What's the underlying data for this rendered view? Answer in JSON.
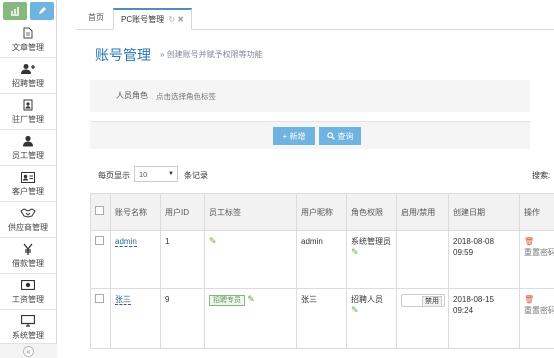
{
  "sidebar": {
    "items": [
      {
        "label": "文章管理",
        "icon": "document-icon"
      },
      {
        "label": "招聘管理",
        "icon": "user-add-icon"
      },
      {
        "label": "驻厂管理",
        "icon": "badge-icon"
      },
      {
        "label": "员工管理",
        "icon": "user-icon"
      },
      {
        "label": "客户管理",
        "icon": "id-card-icon"
      },
      {
        "label": "供应商管理",
        "icon": "handshake-icon"
      },
      {
        "label": "借款管理",
        "icon": "yen-icon"
      },
      {
        "label": "工资管理",
        "icon": "money-icon"
      },
      {
        "label": "系统管理",
        "icon": "monitor-icon"
      }
    ],
    "collapse": "«"
  },
  "tabs": {
    "home": "首页",
    "active": "PC账号管理",
    "active_icons": "↻ ✖"
  },
  "header": {
    "title": "账号管理",
    "subtitle": "» 创建账号并赋予权限等功能"
  },
  "filter": {
    "label": "人员角色",
    "placeholder": "点击选择角色标签"
  },
  "buttons": {
    "add": "+ 新增",
    "query": "查询"
  },
  "list": {
    "page_size_prefix": "每页显示",
    "page_size": "10",
    "page_size_suffix": "条记录",
    "search_label": "搜索:"
  },
  "table": {
    "headers": [
      "",
      "账号名称",
      "用户ID",
      "员工标签",
      "用户昵称",
      "角色权限",
      "启用/禁用",
      "创建日期",
      "操作"
    ],
    "rows": [
      {
        "account": "admin",
        "user_id": "1",
        "tag": "",
        "nickname": "admin",
        "role": "系统管理员",
        "enabled": "",
        "date": "2018-08-08 09:59",
        "op_reset": "重置密码"
      },
      {
        "account": "张三",
        "user_id": "9",
        "tag": "招聘专员",
        "nickname": "张三",
        "role": "招聘人员",
        "enabled": "禁用",
        "date": "2018-08-15 09:24",
        "op_reset": "重置密码"
      }
    ]
  }
}
